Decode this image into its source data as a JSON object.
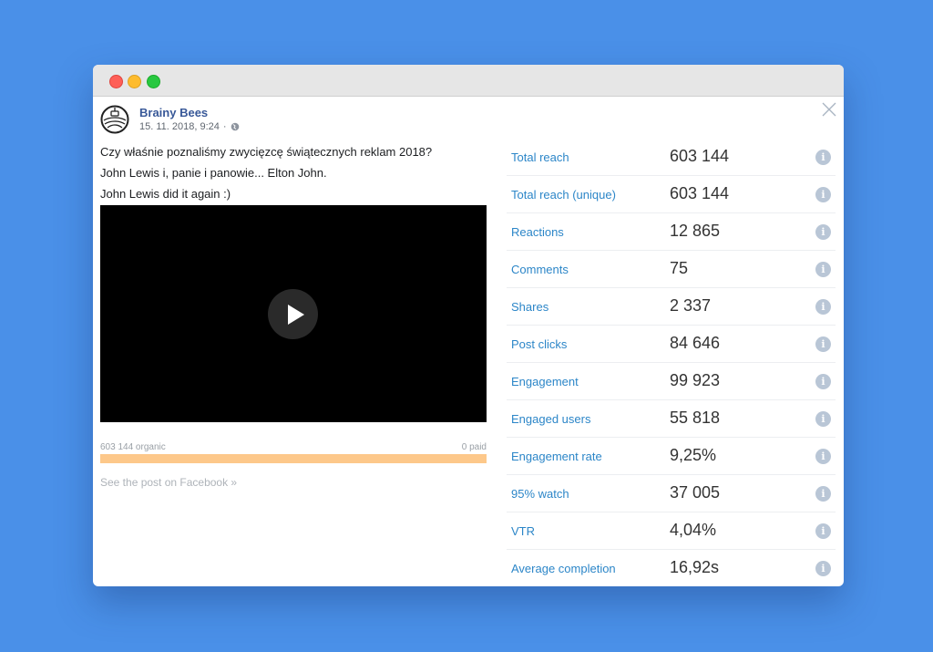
{
  "post": {
    "page_name": "Brainy Bees",
    "date": "15. 11. 2018, 9:24",
    "separator": "·",
    "privacy_icon": "globe-icon",
    "text_lines": [
      "Czy właśnie poznaliśmy zwycięzcę świątecznych reklam 2018?",
      "John Lewis i, panie i panowie... Elton John.",
      "John Lewis did it again :)"
    ],
    "organic_label": "603 144 organic",
    "paid_label": "0 paid",
    "organic_fraction": 1.0,
    "fb_link": "See the post on Facebook »"
  },
  "metrics": [
    {
      "label": "Total reach",
      "value": "603 144"
    },
    {
      "label": "Total reach (unique)",
      "value": "603 144"
    },
    {
      "label": "Reactions",
      "value": "12 865"
    },
    {
      "label": "Comments",
      "value": "75"
    },
    {
      "label": "Shares",
      "value": "2 337"
    },
    {
      "label": "Post clicks",
      "value": "84 646"
    },
    {
      "label": "Engagement",
      "value": "99 923"
    },
    {
      "label": "Engaged users",
      "value": "55 818"
    },
    {
      "label": "Engagement rate",
      "value": "9,25%"
    },
    {
      "label": "95% watch",
      "value": "37 005"
    },
    {
      "label": "VTR",
      "value": "4,04%"
    },
    {
      "label": "Average completion",
      "value": "16,92s"
    }
  ],
  "info_glyph": "i",
  "colors": {
    "background": "#4a90e8",
    "page_name": "#385898",
    "metric_label": "#2c86c8",
    "reach_bar": "#fdc88a"
  }
}
